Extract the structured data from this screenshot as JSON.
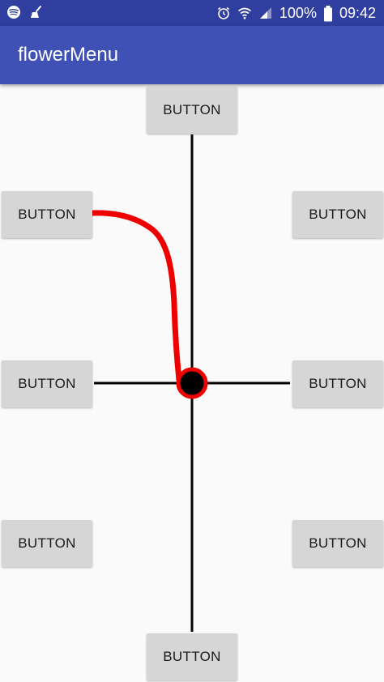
{
  "status_bar": {
    "battery_text": "100%",
    "time": "09:42",
    "icons_left": [
      "spotify-icon",
      "cleaner-broom-icon"
    ],
    "icons_right": [
      "alarm-icon",
      "wifi-icon",
      "signal-icon",
      "battery-icon"
    ]
  },
  "app_bar": {
    "title": "flowerMenu",
    "color": "#3f51b5",
    "status_color": "#303f9f"
  },
  "buttons": {
    "top": "BUTTON",
    "upper_left": "BUTTON",
    "upper_right": "BUTTON",
    "middle_left": "BUTTON",
    "middle_right": "BUTTON",
    "lower_left": "BUTTON",
    "lower_right": "BUTTON",
    "bottom": "BUTTON"
  },
  "colors": {
    "gesture_stroke": "#ee0000",
    "center_dot": "#000000",
    "axis_line": "#000000",
    "button_bg": "#d6d6d6"
  }
}
